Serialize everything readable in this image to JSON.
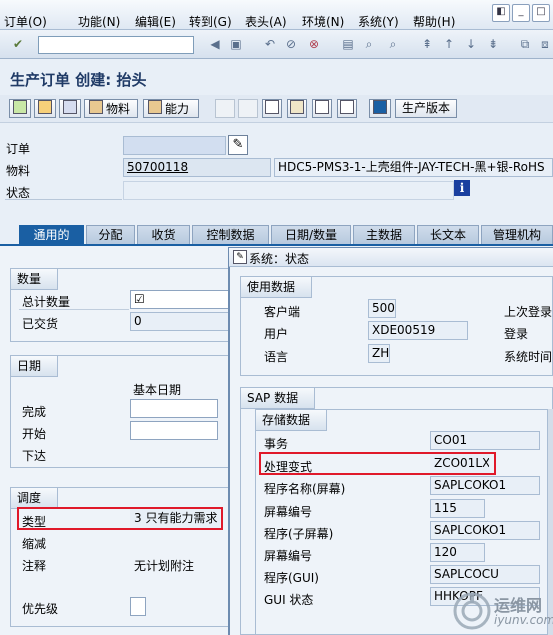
{
  "menubar": {
    "items": [
      "订单(O)",
      "功能(N)",
      "编辑(E)",
      "转到(G)",
      "表头(A)",
      "环境(N)",
      "系统(Y)",
      "帮助(H)"
    ]
  },
  "title": "生产订单 创建: 抬头",
  "app_toolbar": {
    "material_btn": "物料",
    "capacity_btn": "能力",
    "prod_version_btn": "生产版本"
  },
  "header": {
    "order_label": "订单",
    "order_value": "",
    "material_label": "物料",
    "material_value": "50700118",
    "material_desc": "HDC5-PMS3-1-上壳组件-JAY-TECH-黑+银-RoHS",
    "status_label": "状态"
  },
  "tabs": [
    "通用的",
    "分配",
    "收货",
    "控制数据",
    "日期/数量",
    "主数据",
    "长文本",
    "管理机构"
  ],
  "quantity_group": {
    "title": "数量",
    "total_label": "总计数量",
    "total_value": "☑",
    "delivered_label": "已交货",
    "delivered_value": "0"
  },
  "date_group": {
    "title": "日期",
    "basic_date": "基本日期",
    "finish_label": "完成",
    "start_label": "开始",
    "release_label": "下达"
  },
  "scheduling_group": {
    "title": "调度",
    "type_label": "类型",
    "type_value": "3 只有能力需求",
    "reduction_label": "缩减",
    "note_label": "注释",
    "note_value": "无计划附注",
    "priority_label": "优先级"
  },
  "popup": {
    "title": "系统：状态",
    "usage_title": "使用数据",
    "client_label": "客户端",
    "client_value": "500",
    "user_label": "用户",
    "user_value": "XDE00519",
    "language_label": "语言",
    "language_value": "ZH",
    "last_login_label": "上次登录",
    "login_label": "登录",
    "system_time_label": "系统时间",
    "sap_title": "SAP 数据",
    "repo_title": "存储数据",
    "transaction_label": "事务",
    "transaction_value": "CO01",
    "process_label": "处理变式",
    "process_value": "ZCO01LX",
    "program_screen_label": "程序名称(屏幕)",
    "program_screen_value": "SAPLCOKO1",
    "screen_no_label": "屏幕编号",
    "screen_no_value": "115",
    "subprogram_label": "程序(子屏幕)",
    "subprogram_value": "SAPLCOKO1",
    "screen_no2_label": "屏幕编号",
    "screen_no2_value": "120",
    "gui_program_label": "程序(GUI)",
    "gui_program_value": "SAPLCOCU",
    "gui_status_label": "GUI 状态",
    "gui_status_value": "HHKOPF"
  },
  "watermark": {
    "cn": "运维网",
    "url": "iyunv.com"
  },
  "colors": {
    "tab_active": "#1a5fa3",
    "highlight_box": "#e0192a",
    "title_text": "#1f3a66"
  }
}
